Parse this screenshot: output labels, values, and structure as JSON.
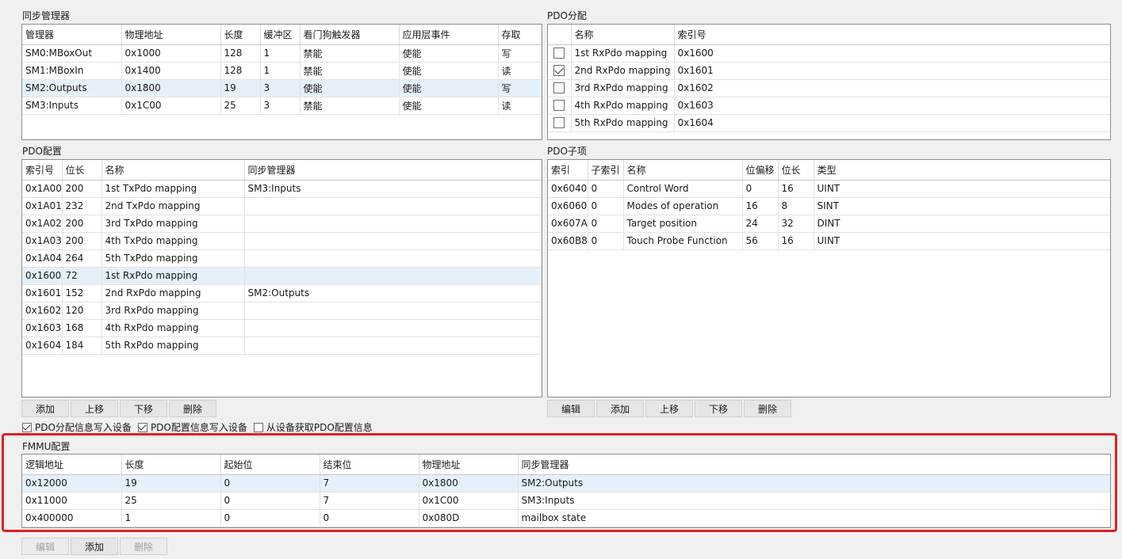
{
  "sync_manager": {
    "title": "同步管理器",
    "headers": [
      "管理器",
      "物理地址",
      "长度",
      "缓冲区",
      "看门狗触发器",
      "应用层事件",
      "存取"
    ],
    "rows": [
      [
        "SM0:MBoxOut",
        "0x1000",
        "128",
        "1",
        "禁能",
        "使能",
        "写"
      ],
      [
        "SM1:MBoxIn",
        "0x1400",
        "128",
        "1",
        "禁能",
        "使能",
        "读"
      ],
      [
        "SM2:Outputs",
        "0x1800",
        "19",
        "3",
        "使能",
        "使能",
        "写"
      ],
      [
        "SM3:Inputs",
        "0x1C00",
        "25",
        "3",
        "禁能",
        "使能",
        "读"
      ]
    ]
  },
  "pdo_assign": {
    "title": "PDO分配",
    "headers": [
      "",
      "名称",
      "索引号"
    ],
    "rows": [
      {
        "checked": false,
        "name": "1st RxPdo mapping",
        "index": "0x1600"
      },
      {
        "checked": true,
        "name": "2nd RxPdo mapping",
        "index": "0x1601"
      },
      {
        "checked": false,
        "name": "3rd RxPdo mapping",
        "index": "0x1602"
      },
      {
        "checked": false,
        "name": "4th RxPdo mapping",
        "index": "0x1603"
      },
      {
        "checked": false,
        "name": "5th RxPdo mapping",
        "index": "0x1604"
      }
    ]
  },
  "pdo_config": {
    "title": "PDO配置",
    "headers": [
      "索引号",
      "位长",
      "名称",
      "同步管理器"
    ],
    "rows": [
      [
        "0x1A00",
        "200",
        "1st TxPdo mapping",
        "SM3:Inputs"
      ],
      [
        "0x1A01",
        "232",
        "2nd TxPdo mapping",
        ""
      ],
      [
        "0x1A02",
        "200",
        "3rd TxPdo mapping",
        ""
      ],
      [
        "0x1A03",
        "200",
        "4th TxPdo mapping",
        ""
      ],
      [
        "0x1A04",
        "264",
        "5th TxPdo mapping",
        ""
      ],
      [
        "0x1600",
        "72",
        "1st RxPdo mapping",
        ""
      ],
      [
        "0x1601",
        "152",
        "2nd RxPdo mapping",
        "SM2:Outputs"
      ],
      [
        "0x1602",
        "120",
        "3rd RxPdo mapping",
        ""
      ],
      [
        "0x1603",
        "168",
        "4th RxPdo mapping",
        ""
      ],
      [
        "0x1604",
        "184",
        "5th RxPdo mapping",
        ""
      ]
    ],
    "buttons": [
      "添加",
      "上移",
      "下移",
      "删除"
    ]
  },
  "pdo_entries": {
    "title": "PDO子项",
    "headers": [
      "索引",
      "子索引",
      "名称",
      "位偏移",
      "位长",
      "类型"
    ],
    "rows": [
      [
        "0x6040",
        "0",
        "Control Word",
        "0",
        "16",
        "UINT"
      ],
      [
        "0x6060",
        "0",
        "Modes of operation",
        "16",
        "8",
        "SINT"
      ],
      [
        "0x607A",
        "0",
        "Target position",
        "24",
        "32",
        "DINT"
      ],
      [
        "0x60B8",
        "0",
        "Touch Probe Function",
        "56",
        "16",
        "UINT"
      ]
    ],
    "buttons": [
      "编辑",
      "添加",
      "上移",
      "下移",
      "删除"
    ]
  },
  "options": [
    {
      "label": "PDO分配信息写入设备",
      "checked": true
    },
    {
      "label": "PDO配置信息写入设备",
      "checked": true
    },
    {
      "label": "从设备获取PDO配置信息",
      "checked": false
    }
  ],
  "fmmu": {
    "title": "FMMU配置",
    "headers": [
      "逻辑地址",
      "长度",
      "起始位",
      "结束位",
      "物理地址",
      "同步管理器"
    ],
    "rows": [
      [
        "0x12000",
        "19",
        "0",
        "7",
        "0x1800",
        "SM2:Outputs"
      ],
      [
        "0x11000",
        "25",
        "0",
        "7",
        "0x1C00",
        "SM3:Inputs"
      ],
      [
        "0x400000",
        "1",
        "0",
        "0",
        "0x080D",
        "mailbox state"
      ]
    ],
    "buttons": [
      {
        "label": "编辑",
        "enabled": false
      },
      {
        "label": "添加",
        "enabled": true
      },
      {
        "label": "删除",
        "enabled": false
      }
    ]
  },
  "colors": {
    "selection": "#e5f0fb",
    "highlight_border": "#e02020"
  }
}
